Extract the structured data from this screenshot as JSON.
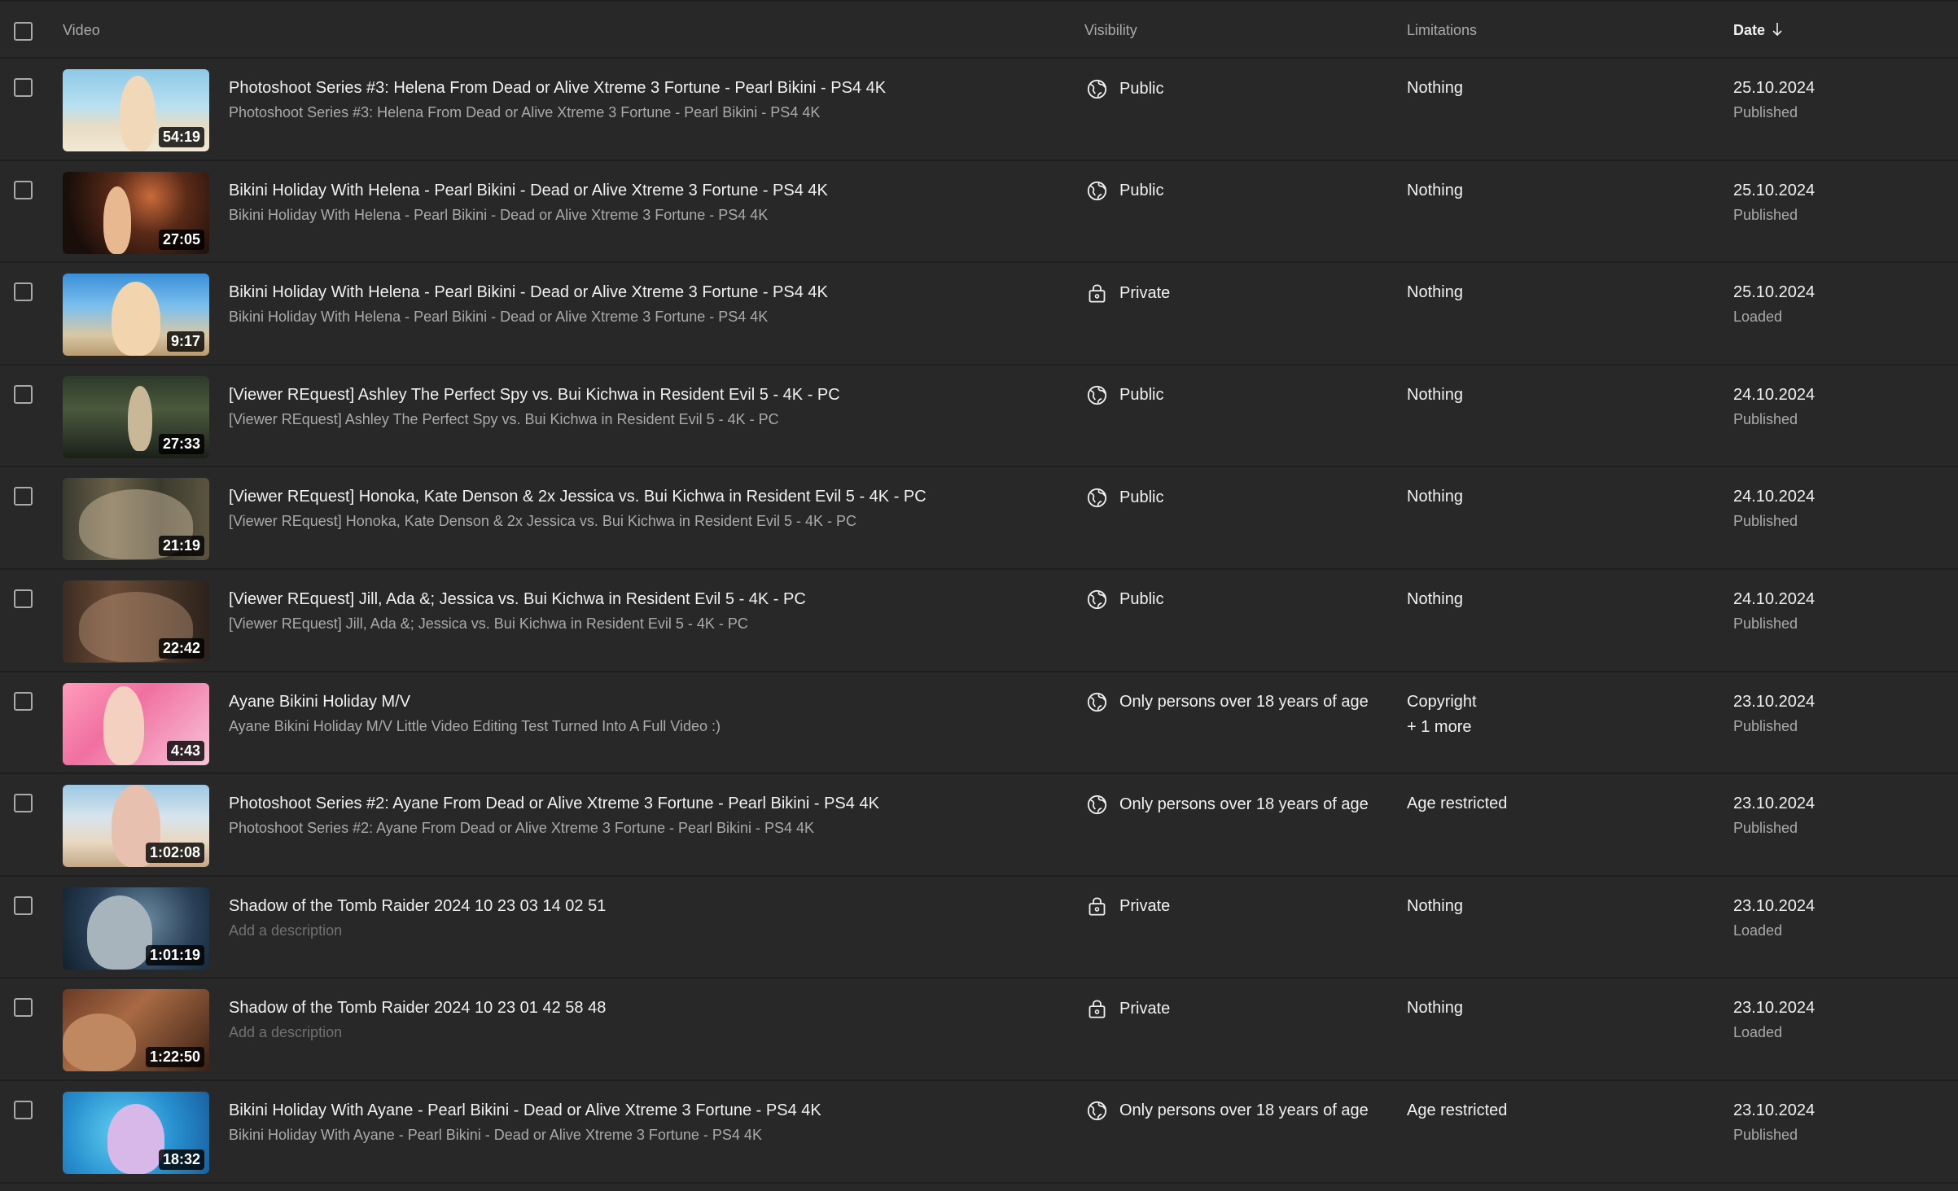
{
  "header": {
    "video": "Video",
    "visibility": "Visibility",
    "limitations": "Limitations",
    "date": "Date",
    "date_sort_icon": "arrow-down-icon"
  },
  "rows": [
    {
      "duration": "54:19",
      "title": "Photoshoot Series #3: Helena From Dead or Alive Xtreme 3 Fortune - Pearl Bikini - PS4 4K",
      "description": "Photoshoot Series #3: Helena From Dead or Alive Xtreme 3 Fortune - Pearl Bikini - PS4 4K",
      "visibility_icon": "globe-icon",
      "visibility": "Public",
      "limitation": "Nothing",
      "limitation_extra": "",
      "date": "25.10.2024",
      "status": "Published"
    },
    {
      "duration": "27:05",
      "title": "Bikini Holiday With Helena - Pearl Bikini - Dead or Alive Xtreme 3 Fortune - PS4 4K",
      "description": "Bikini Holiday With Helena - Pearl Bikini - Dead or Alive Xtreme 3 Fortune - PS4 4K",
      "visibility_icon": "globe-icon",
      "visibility": "Public",
      "limitation": "Nothing",
      "limitation_extra": "",
      "date": "25.10.2024",
      "status": "Published"
    },
    {
      "duration": "9:17",
      "title": "Bikini Holiday With Helena - Pearl Bikini - Dead or Alive Xtreme 3 Fortune - PS4 4K",
      "description": "Bikini Holiday With Helena - Pearl Bikini - Dead or Alive Xtreme 3 Fortune - PS4 4K",
      "visibility_icon": "lock-icon",
      "visibility": "Private",
      "limitation": "Nothing",
      "limitation_extra": "",
      "date": "25.10.2024",
      "status": "Loaded"
    },
    {
      "duration": "27:33",
      "title": "[Viewer REquest] Ashley The Perfect Spy vs. Bui Kichwa in Resident Evil 5 - 4K - PC",
      "description": "[Viewer REquest] Ashley The Perfect Spy vs. Bui Kichwa in Resident Evil 5 - 4K - PC",
      "visibility_icon": "globe-icon",
      "visibility": "Public",
      "limitation": "Nothing",
      "limitation_extra": "",
      "date": "24.10.2024",
      "status": "Published"
    },
    {
      "duration": "21:19",
      "title": "[Viewer REquest] Honoka, Kate Denson & 2x Jessica vs. Bui Kichwa in Resident Evil 5 - 4K - PC",
      "description": "[Viewer REquest] Honoka, Kate Denson & 2x Jessica vs. Bui Kichwa in Resident Evil 5 - 4K - PC",
      "visibility_icon": "globe-icon",
      "visibility": "Public",
      "limitation": "Nothing",
      "limitation_extra": "",
      "date": "24.10.2024",
      "status": "Published"
    },
    {
      "duration": "22:42",
      "title": "[Viewer REquest] Jill, Ada &; Jessica vs. Bui Kichwa in Resident Evil 5 - 4K - PC",
      "description": "[Viewer REquest] Jill, Ada &; Jessica vs. Bui Kichwa in Resident Evil 5 - 4K - PC",
      "visibility_icon": "globe-icon",
      "visibility": "Public",
      "limitation": "Nothing",
      "limitation_extra": "",
      "date": "24.10.2024",
      "status": "Published"
    },
    {
      "duration": "4:43",
      "title": "Ayane Bikini Holiday M/V",
      "description": "Ayane Bikini Holiday M/V Little Video Editing Test Turned Into A Full Video :)",
      "visibility_icon": "globe-icon",
      "visibility": "Only persons over 18 years of age",
      "limitation": "Copyright",
      "limitation_extra": "+ 1 more",
      "date": "23.10.2024",
      "status": "Published"
    },
    {
      "duration": "1:02:08",
      "title": "Photoshoot Series #2: Ayane From Dead or Alive Xtreme 3 Fortune - Pearl Bikini - PS4 4K",
      "description": "Photoshoot Series #2: Ayane From Dead or Alive Xtreme 3 Fortune - Pearl Bikini - PS4 4K",
      "visibility_icon": "globe-icon",
      "visibility": "Only persons over 18 years of age",
      "limitation": "Age restricted",
      "limitation_extra": "",
      "date": "23.10.2024",
      "status": "Published"
    },
    {
      "duration": "1:01:19",
      "title": "Shadow of the Tomb Raider 2024 10 23 03 14 02 51",
      "description": "Add a description",
      "visibility_icon": "lock-icon",
      "visibility": "Private",
      "limitation": "Nothing",
      "limitation_extra": "",
      "date": "23.10.2024",
      "status": "Loaded"
    },
    {
      "duration": "1:22:50",
      "title": "Shadow of the Tomb Raider 2024 10 23 01 42 58 48",
      "description": "Add a description",
      "visibility_icon": "lock-icon",
      "visibility": "Private",
      "limitation": "Nothing",
      "limitation_extra": "",
      "date": "23.10.2024",
      "status": "Loaded"
    },
    {
      "duration": "18:32",
      "title": "Bikini Holiday With Ayane - Pearl Bikini - Dead or Alive Xtreme 3 Fortune - PS4 4K",
      "description": "Bikini Holiday With Ayane - Pearl Bikini - Dead or Alive Xtreme 3 Fortune - PS4 4K",
      "visibility_icon": "globe-icon",
      "visibility": "Only persons over 18 years of age",
      "limitation": "Age restricted",
      "limitation_extra": "",
      "date": "23.10.2024",
      "status": "Published"
    }
  ],
  "colors": {
    "background": "#282828",
    "divider": "#1f1f1f",
    "text_primary": "#f1f1f1",
    "text_secondary": "#aaaaaa"
  }
}
